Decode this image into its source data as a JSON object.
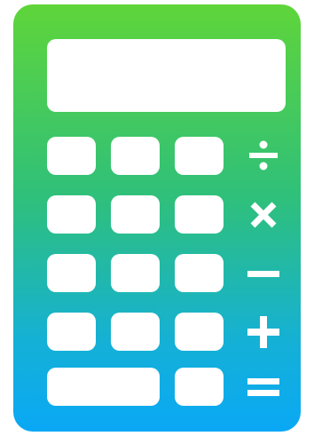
{
  "calculator": {
    "display": {
      "value": ""
    },
    "buttons": [
      {
        "row": 1,
        "ops": "divide"
      },
      {
        "row": 2,
        "ops": "multiply"
      },
      {
        "row": 3,
        "ops": "subtract"
      },
      {
        "row": 4,
        "ops": "add"
      },
      {
        "row": 5,
        "ops": "equals"
      }
    ],
    "icons": [
      "divide-icon",
      "multiply-icon",
      "minus-icon",
      "plus-icon",
      "equals-icon"
    ],
    "colors": {
      "gradient_top": "#5fd53a",
      "gradient_bottom": "#0aa8f5",
      "keys": "#ffffff"
    }
  }
}
